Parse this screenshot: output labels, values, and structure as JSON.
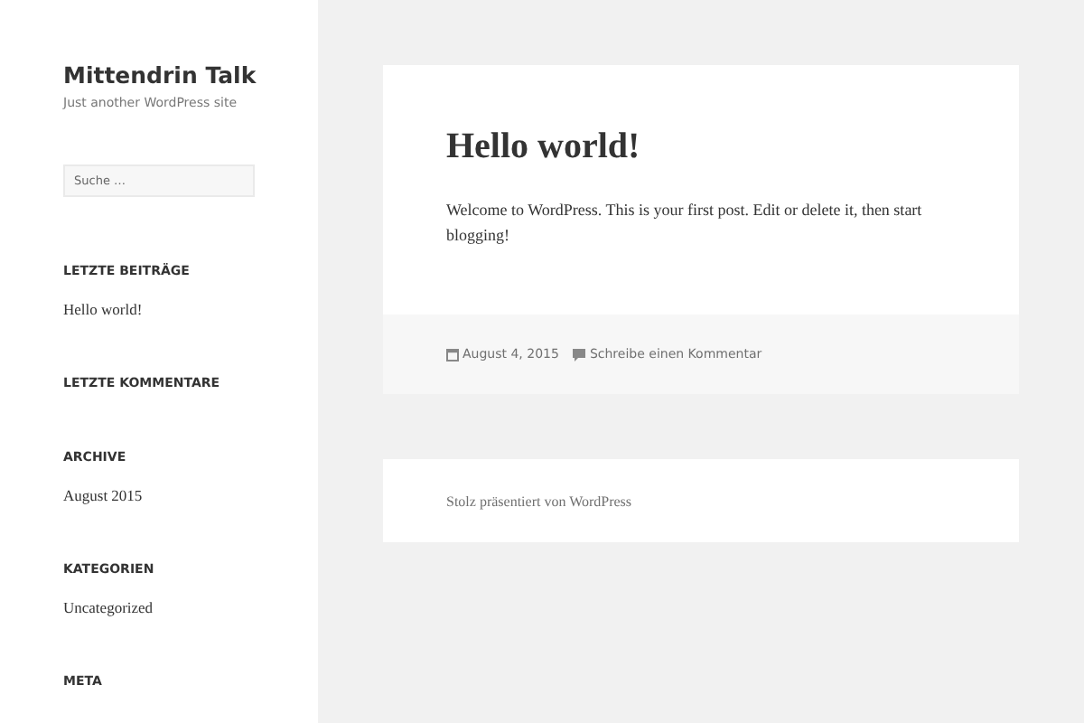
{
  "site": {
    "title": "Mittendrin Talk",
    "tagline": "Just another WordPress site"
  },
  "search": {
    "placeholder": "Suche …"
  },
  "widgets": [
    {
      "heading": "LETZTE BEITRÄGE",
      "items": [
        "Hello world!"
      ]
    },
    {
      "heading": "LETZTE KOMMENTARE"
    },
    {
      "heading": "ARCHIVE",
      "items": [
        "August 2015"
      ]
    },
    {
      "heading": "KATEGORIEN",
      "items": [
        "Uncategorized"
      ]
    },
    {
      "heading": "META"
    }
  ],
  "post": {
    "title": "Hello world!",
    "body": "Welcome to WordPress. This is your first post. Edit or delete it, then start blogging!",
    "date": "August 4, 2015",
    "comment_link": "Schreibe einen Kommentar"
  },
  "footer": {
    "credit": "Stolz präsentiert von WordPress"
  }
}
